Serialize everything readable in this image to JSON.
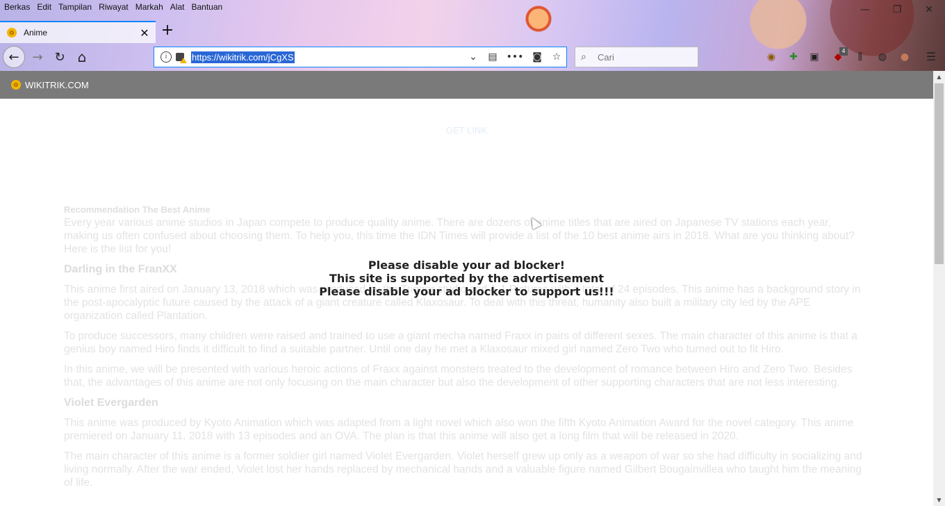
{
  "menubar": {
    "items": [
      "Berkas",
      "Edit",
      "Tampilan",
      "Riwayat",
      "Markah",
      "Alat",
      "Bantuan"
    ]
  },
  "window_controls": {
    "minimize": "—",
    "restore": "❐",
    "close": "✕"
  },
  "tab": {
    "title": "Anime",
    "close": "✕",
    "favicon_glyph": "❂"
  },
  "newtab": {
    "label": "+"
  },
  "nav": {
    "back": "←",
    "forward": "→",
    "reload": "↻",
    "home": "⌂"
  },
  "urlbar": {
    "url": "https://wikitrik.com/jCgXS",
    "info_glyph": "i",
    "dropdown": "⌄",
    "reader": "▤",
    "more": "•••",
    "pocket": "◙",
    "bookmark": "☆"
  },
  "search": {
    "placeholder": "Cari",
    "icon": "⌕"
  },
  "extensions": {
    "badge": "4",
    "icons": [
      "◉",
      "✚",
      "▣",
      "◆",
      "⫼",
      "◍",
      "●",
      "☰"
    ]
  },
  "site": {
    "name": "WIKITRIK.COM",
    "logo_glyph": "❂"
  },
  "page": {
    "get_link": "GET LINK",
    "rec_heading": "Recommendation The Best Anime",
    "intro": "Every year various anime studios in Japan compete to produce quality anime. There are dozens of anime titles that are aired on Japanese TV stations each year, making us often confused about choosing them. To help you, this time the IDN Times will provide a list of the 10 best anime airs in 2018. What are you thinking about? Here is the list for you!",
    "h1": "Darling in the FranXX",
    "p1": "This anime first aired on January 13, 2018 which was produced by the Trigger studio and A-1 Pictures with a total of 24 episodes. This anime has a background story in the post-apocalyptic future caused by the attack of a giant creature called Klaxosaur. To deal with this threat, humanity also built a military city led by the APE organization called Plantation.",
    "p2": "To produce successors, many children were raised and trained to use a giant mecha named Fraxx in pairs of different sexes. The main character of this anime is that a genius boy named Hiro finds it difficult to find a suitable partner. Until one day he met a Klaxosaur mixed girl named Zero Two who turned out to fit Hiro.",
    "p3": "In this anime, we will be presented with various heroic actions of Fraxx against monsters treated to the development of romance between Hiro and Zero Two. Besides that, the advantages of this anime are not only focusing on the main character but also the development of other supporting characters that are not less interesting.",
    "h2": "Violet Evergarden",
    "p4": "This anime was produced by Kyoto Animation which was adapted from a light novel which also won the fifth Kyoto Animation Award for the novel category. This anime premiered on January 11, 2018 with 13 episodes and an OVA. The plan is that this anime will also get a long film that will be released in 2020.",
    "p5": "The main character of this anime is a former soldier girl named Violet Evergarden. Violet herself grew up only as a weapon of war so she had difficulty in socializing and living normally. After the war ended, Violet lost her hands replaced by mechanical hands and a valuable figure named Gilbert Bougainvillea who taught him the meaning of life."
  },
  "overlay": {
    "line1": "Please disable your ad blocker!",
    "line2": "This site is supported by the advertisement",
    "line3": "Please disable your ad blocker to support us!!!"
  },
  "scrollbar": {
    "up": "▲",
    "down": "▼"
  }
}
